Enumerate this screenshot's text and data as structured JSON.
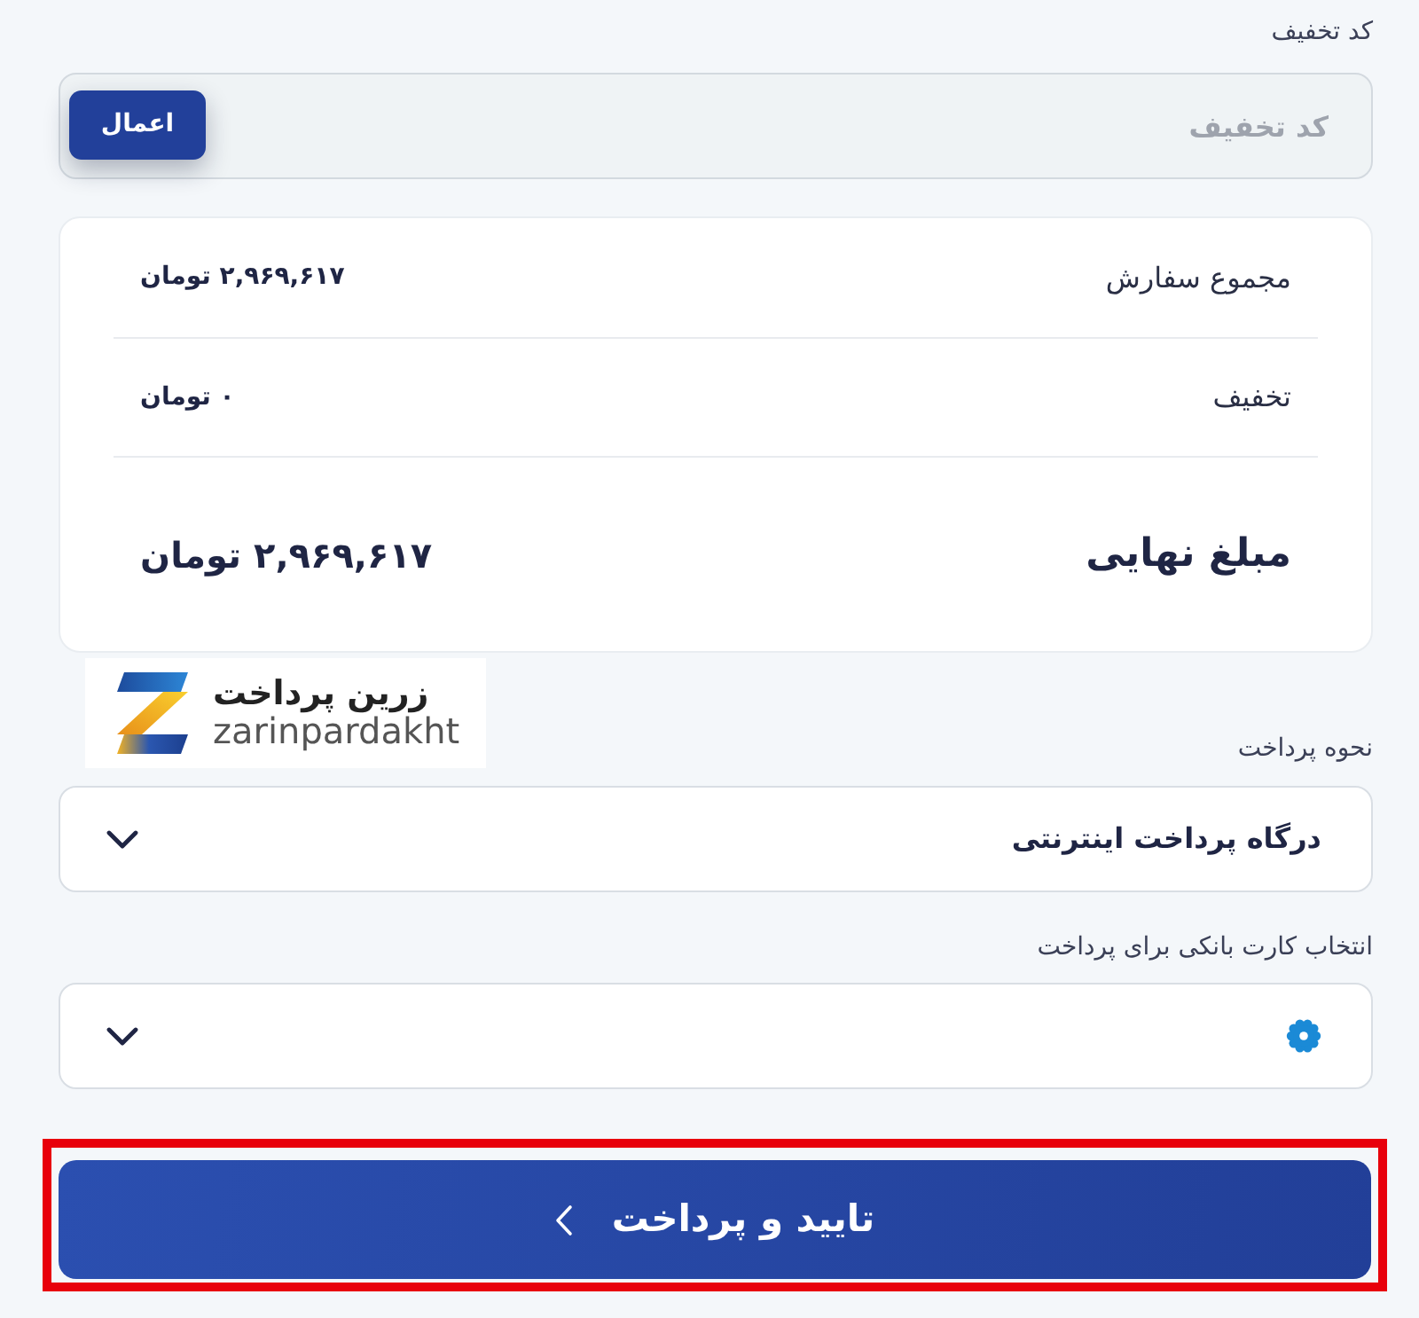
{
  "discount": {
    "label": "کد تخفیف",
    "placeholder": "کد تخفیف",
    "button": "اعمال"
  },
  "summary": {
    "rows": [
      {
        "kind": "normal",
        "label": "مجموع سفارش",
        "value": "۲,۹۶۹,۶۱۷ تومان"
      },
      {
        "kind": "normal",
        "label": "تخفیف",
        "value": "۰ تومان"
      },
      {
        "kind": "total",
        "label": "مبلغ نهایی",
        "value": "۲,۹۶۹,۶۱۷ تومان"
      }
    ]
  },
  "gateway_logo": {
    "title": "زرین پرداخت",
    "subtitle": "zarinpardakht"
  },
  "payment_method": {
    "label": "نحوه پرداخت",
    "value": "درگاه پرداخت اینترنتی"
  },
  "bank_card": {
    "label": "انتخاب کارت بانکی برای پرداخت"
  },
  "submit": {
    "label": "تایید و پرداخت",
    "highlighted": true
  }
}
